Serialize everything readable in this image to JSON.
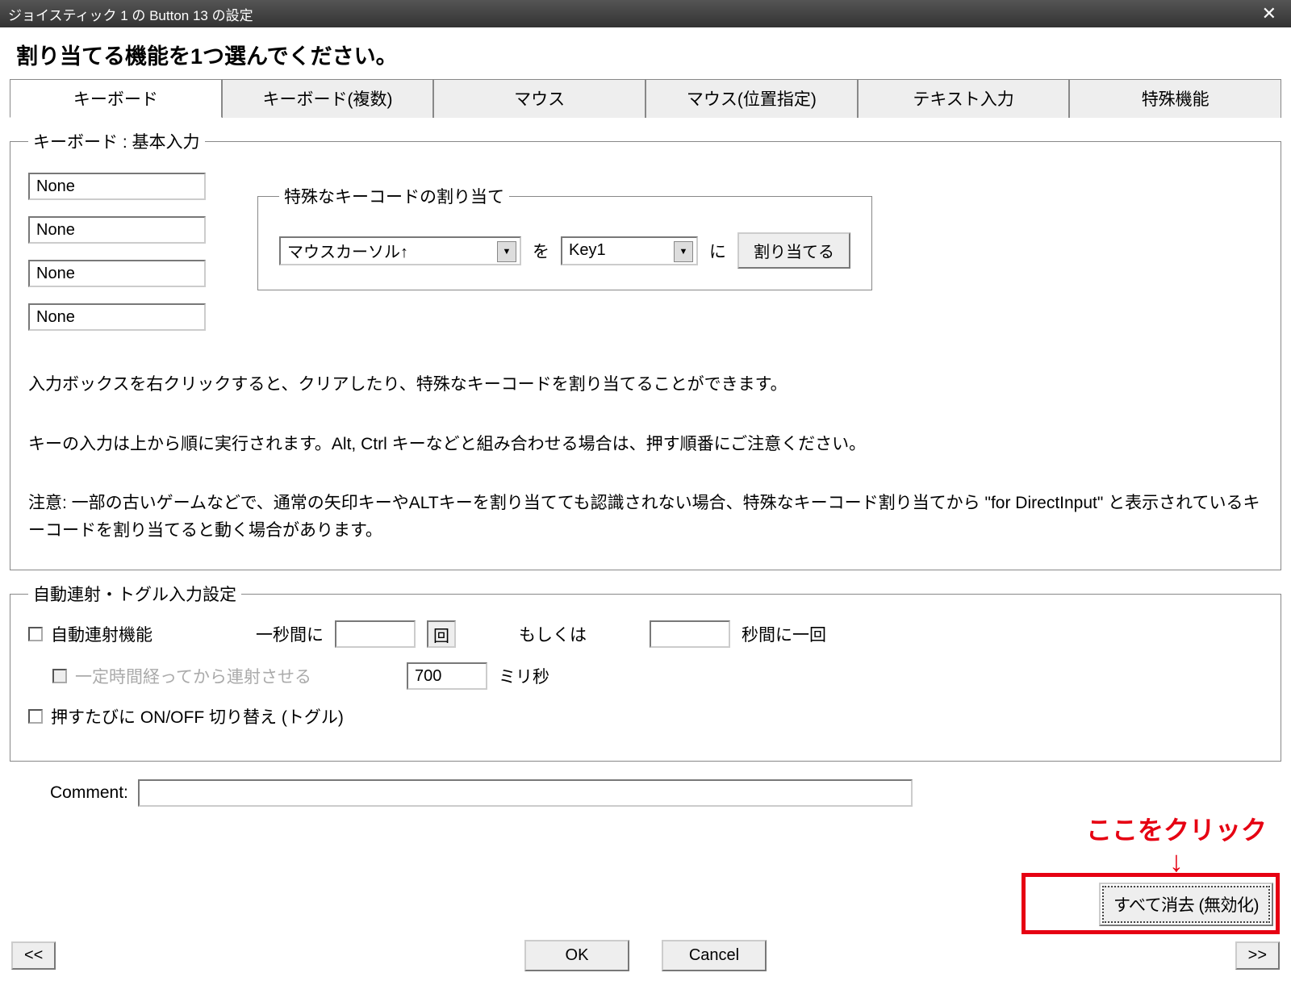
{
  "window": {
    "title": "ジョイスティック 1 の Button 13 の設定"
  },
  "heading": "割り当てる機能を1つ選んでください。",
  "tabs": [
    "キーボード",
    "キーボード(複数)",
    "マウス",
    "マウス(位置指定)",
    "テキスト入力",
    "特殊機能"
  ],
  "keyboard_section": {
    "legend": "キーボード : 基本入力",
    "keys": [
      "None",
      "None",
      "None",
      "None"
    ],
    "special": {
      "legend": "特殊なキーコードの割り当て",
      "code_value": "マウスカーソル↑",
      "sep1": "を",
      "key_value": "Key1",
      "sep2": "に",
      "assign_btn": "割り当てる"
    },
    "help1": "入力ボックスを右クリックすると、クリアしたり、特殊なキーコードを割り当てることができます。",
    "help2": "キーの入力は上から順に実行されます。Alt, Ctrl キーなどと組み合わせる場合は、押す順番にご注意ください。",
    "help3": "注意: 一部の古いゲームなどで、通常の矢印キーやALTキーを割り当てても認識されない場合、特殊なキーコード割り当てから \"for DirectInput\" と表示されているキーコードを割り当てると動く場合があります。"
  },
  "auto_section": {
    "legend": "自動連射・トグル入力設定",
    "autofire": "自動連射機能",
    "per_sec_pre": "一秒間に",
    "per_sec_val": "",
    "per_sec_suffix": "回",
    "or": "もしくは",
    "interval_val": "",
    "interval_suffix": "秒間に一回",
    "delay_label": "一定時間経ってから連射させる",
    "delay_val": "700",
    "delay_suffix": "ミリ秒",
    "toggle": "押すたびに ON/OFF 切り替え (トグル)"
  },
  "comment_label": "Comment:",
  "annotation": {
    "text": "ここをクリック",
    "arrow": "↓"
  },
  "clear_btn": "すべて消去 (無効化)",
  "buttons": {
    "prev": "<<",
    "ok": "OK",
    "cancel": "Cancel",
    "next": ">>"
  }
}
